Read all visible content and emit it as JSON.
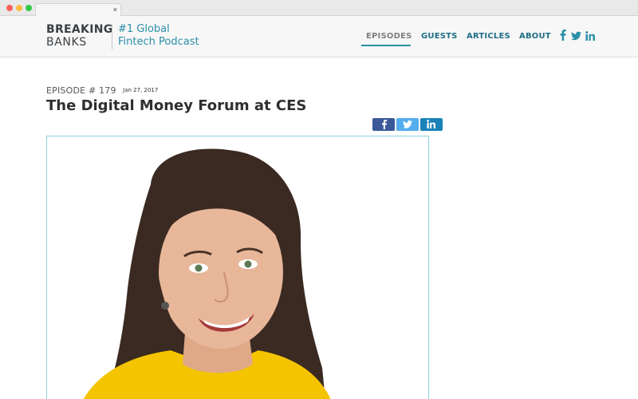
{
  "browser": {
    "tab_close": "×"
  },
  "header": {
    "logo": {
      "line1": "BREAKING",
      "line2": "BANKS"
    },
    "tagline": {
      "line1": "#1 Global",
      "line2": "Fintech Podcast"
    },
    "nav": [
      {
        "label": "EPISODES",
        "active": true
      },
      {
        "label": "GUESTS",
        "active": false
      },
      {
        "label": "ARTICLES",
        "active": false
      },
      {
        "label": "ABOUT",
        "active": false
      }
    ],
    "social": [
      "facebook-icon",
      "twitter-icon",
      "linkedin-icon"
    ]
  },
  "episode": {
    "label": "EPISODE # 179",
    "date": "Jan 27, 2017",
    "title": "The Digital Money Forum at CES"
  },
  "share": [
    "facebook-icon",
    "twitter-icon",
    "linkedin-icon"
  ],
  "colors": {
    "accent": "#2a8fa8",
    "nav": "#1f6e86",
    "facebook": "#3b5998",
    "twitter": "#55acee",
    "linkedin": "#1b82b9",
    "sweater": "#f5c400",
    "hair": "#3a2a22",
    "skin": "#e8b79a"
  }
}
